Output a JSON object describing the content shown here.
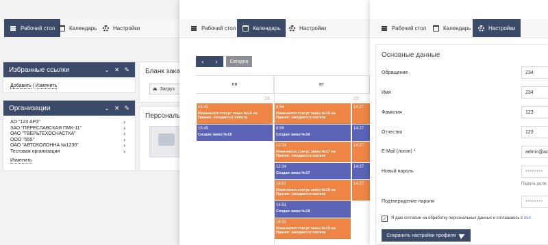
{
  "nav": {
    "desktop": "Рабочий стол",
    "calendar": "Календарь",
    "settings": "Настройки"
  },
  "desktop_panel": {
    "favorites": {
      "title": "Избранные ссылки",
      "add_label": "Добавить",
      "separator": "|",
      "edit_label": "Изменить"
    },
    "organizations": {
      "title": "Организации",
      "items": [
        "АО \"123 АРЗ\"",
        "ЗАО \"ПЕРЕСЛАВСКАЯ ПМК-11\"",
        "ОАО \"ТВЕРЬТЕХОСНАСТКА\"",
        "ООО \"555\"",
        "ОАО \"АВТОКОЛОННА №1230\"",
        "Тестовая организация"
      ],
      "edit_label": "Изменить"
    },
    "blank_card_title": "Бланк зака",
    "load_label": "Загруз",
    "personal_card_title": "Персональ"
  },
  "calendar_panel": {
    "prev": "‹",
    "next": "›",
    "today": "Сегодня",
    "columns": [
      "пн",
      "вт"
    ],
    "day_numbers": [
      "28",
      "29"
    ],
    "events_mon": [
      {
        "time": "15:45",
        "text": "Изменился статус заказ №15 на Принят, ожидается оплата",
        "color": "o"
      },
      {
        "time": "15:45",
        "text": "Создан заказ №15",
        "color": "b"
      }
    ],
    "events_tue": [
      {
        "time": "8:56",
        "text": "Изменился статус заказ №16 на Принят, ожидается оплата",
        "color": "o"
      },
      {
        "time": "8:56",
        "text": "Создан заказ №16",
        "color": "b"
      },
      {
        "time": "12:24",
        "text": "Изменился статус заказ №17 на Принят, ожидается оплата",
        "color": "o"
      },
      {
        "time": "12:24",
        "text": "Создан заказ №17",
        "color": "b"
      },
      {
        "time": "14:51",
        "text": "Изменился статус заказ №18 на Принят, ожидается оплата",
        "color": "o"
      },
      {
        "time": "14:51",
        "text": "Создан заказ №18",
        "color": "b"
      },
      {
        "time": "14:52",
        "text": "Изменился статус заказ №19 на Принят, ожидается оплата",
        "color": "o"
      }
    ],
    "events_wed": [
      {
        "time": "14:27",
        "color": "o"
      },
      {
        "time": "14:27",
        "color": "b"
      },
      {
        "time": "14:27",
        "color": "o"
      },
      {
        "time": "14:27",
        "color": "b"
      },
      {
        "time": "14:27",
        "color": "o"
      }
    ]
  },
  "settings_panel": {
    "section_title": "Основные данные",
    "fields": {
      "salutation": {
        "label": "Обращение",
        "value": "234"
      },
      "first_name": {
        "label": "Имя",
        "value": "234"
      },
      "last_name": {
        "label": "Фамилия",
        "value": "123"
      },
      "patronymic": {
        "label": "Отчество",
        "value": "123"
      },
      "email": {
        "label": "E-Mail (логин) *",
        "value": "admin@ad"
      },
      "new_password": {
        "label": "Новый пароль",
        "placeholder": "********"
      },
      "confirm_password": {
        "label": "Подтверждение пароля",
        "placeholder": "********"
      }
    },
    "password_hint": "Пароль долж",
    "consent_text": "Я даю согласие на обработку персональных данных и соглашаюсь с ",
    "consent_link": "пол",
    "checkbox_mark": "✓",
    "save_label": "Сохранить настройки профиля"
  },
  "colors": {
    "header": "#3a4a68",
    "event_orange": "#ee8545",
    "event_blue": "#5a63b5"
  }
}
